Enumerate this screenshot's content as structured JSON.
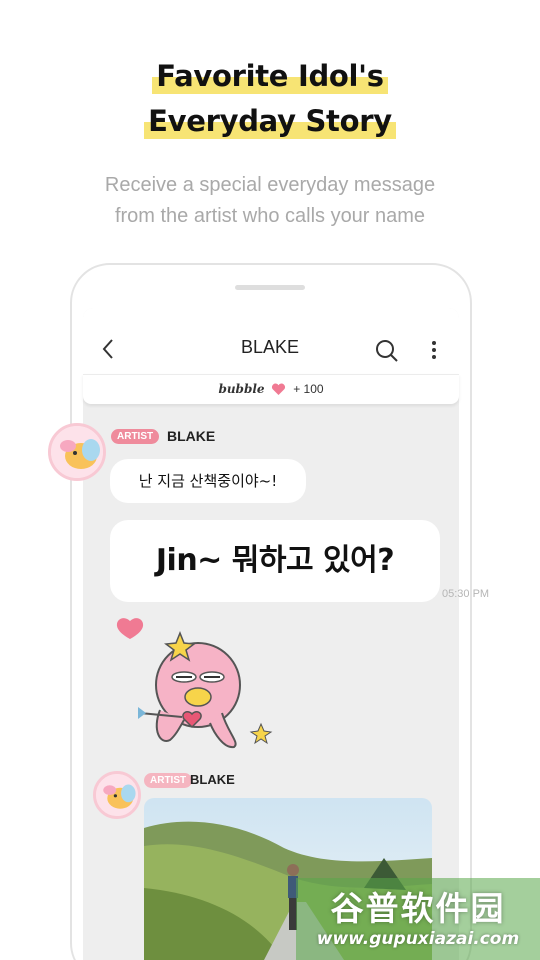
{
  "headline": {
    "line1": "Favorite Idol's",
    "line2": "Everyday Story",
    "highlight_color": "#f7e474"
  },
  "subtitle": {
    "line1": "Receive a special everyday message",
    "line2": "from the artist who calls your name"
  },
  "chat": {
    "title": "BLAKE",
    "back_icon": "chevron-left-icon",
    "search_icon": "search-icon",
    "more_icon": "more-vertical-icon",
    "bubble_strip": {
      "logo": "bubble",
      "count": "+ 100",
      "heart_color": "#f07a93"
    },
    "messages": [
      {
        "badge": "ARTIST",
        "sender": "BLAKE",
        "bubbles": [
          "난 지금 산책중이야~!",
          "Jin~ 뭐하고 있어?"
        ],
        "time": "05:30 PM"
      },
      {
        "badge": "ARTIST",
        "sender": "BLAKE",
        "attachment": "photo"
      }
    ],
    "badge_color": "#ef8b9c"
  },
  "watermark": {
    "cn": "谷普软件园",
    "url": "www.gupuxiazai.com"
  }
}
